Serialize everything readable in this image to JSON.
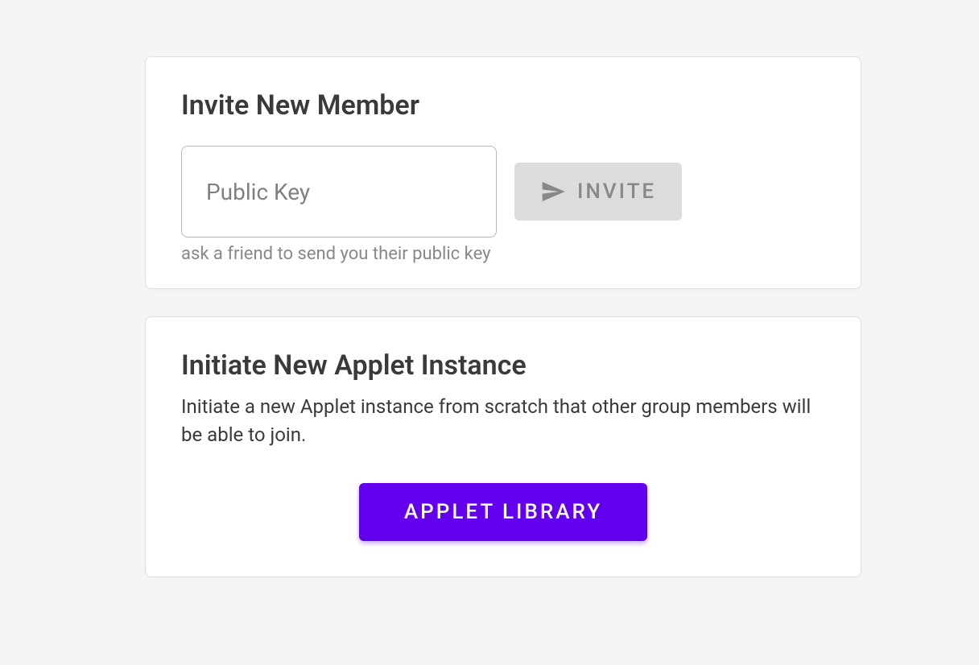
{
  "invite_card": {
    "title": "Invite New Member",
    "public_key_placeholder": "Public Key",
    "invite_button_label": "INVITE",
    "helper_text": "ask a friend to send you their public key"
  },
  "applet_card": {
    "title": "Initiate New Applet Instance",
    "description": "Initiate a new Applet instance from scratch that other group members will be able to join.",
    "library_button_label": "APPLET LIBRARY"
  }
}
